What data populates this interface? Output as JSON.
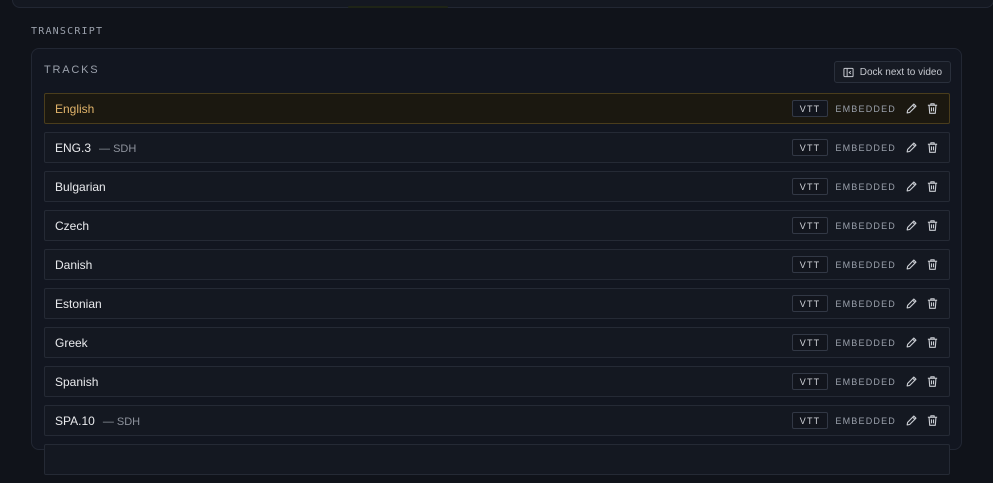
{
  "section": {
    "title": "TRANSCRIPT"
  },
  "tracks_panel": {
    "header": "TRACKS",
    "dock_button_label": "Dock next to video"
  },
  "tracks": [
    {
      "name": "English",
      "sub": "",
      "format": "VTT",
      "source": "EMBEDDED",
      "active": true
    },
    {
      "name": "ENG.3",
      "sub": "— SDH",
      "format": "VTT",
      "source": "EMBEDDED",
      "active": false
    },
    {
      "name": "Bulgarian",
      "sub": "",
      "format": "VTT",
      "source": "EMBEDDED",
      "active": false
    },
    {
      "name": "Czech",
      "sub": "",
      "format": "VTT",
      "source": "EMBEDDED",
      "active": false
    },
    {
      "name": "Danish",
      "sub": "",
      "format": "VTT",
      "source": "EMBEDDED",
      "active": false
    },
    {
      "name": "Estonian",
      "sub": "",
      "format": "VTT",
      "source": "EMBEDDED",
      "active": false
    },
    {
      "name": "Greek",
      "sub": "",
      "format": "VTT",
      "source": "EMBEDDED",
      "active": false
    },
    {
      "name": "Spanish",
      "sub": "",
      "format": "VTT",
      "source": "EMBEDDED",
      "active": false
    },
    {
      "name": "SPA.10",
      "sub": "— SDH",
      "format": "VTT",
      "source": "EMBEDDED",
      "active": false
    },
    {
      "name": "",
      "sub": "",
      "format": "",
      "source": "",
      "active": false
    }
  ],
  "icons": {
    "dock": "dock-panel-icon",
    "edit": "pencil-icon",
    "delete": "trash-icon"
  },
  "colors": {
    "background": "#10131a",
    "active_text": "#e0b36a",
    "active_border": "#4a3d1c"
  }
}
